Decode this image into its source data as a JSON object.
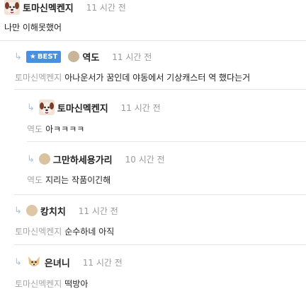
{
  "comments": [
    {
      "nick": "토마신멕켄지",
      "time": "11 시간 전",
      "mention": "",
      "text": "나만 이해못했어"
    },
    {
      "badge": "BEST",
      "nick": "역도",
      "time": "11 시간 전",
      "mention": "토마신멕켄지",
      "text": "아나운서가 꿈인데 야동에서 기상캐스터 역 했다는거"
    },
    {
      "nick": "토마신멕켄지",
      "time": "11 시간 전",
      "mention": "역도",
      "text": "아ㅋㅋㅋㅋ"
    },
    {
      "nick": "그만하세용가리",
      "time": "10 시간 전",
      "mention": "역도",
      "text": "지리는 작품이긴해"
    },
    {
      "nick": "캉치치",
      "time": "11 시간 전",
      "mention": "토마신멕켄지",
      "text": "순수하네 아직"
    },
    {
      "nick": "은녀니",
      "time": "11 시간 전",
      "mention": "토마신멕켄지",
      "text": "떡방아"
    }
  ],
  "icons": {
    "reply": "reply-arrow-icon",
    "best_star": "star-icon"
  },
  "colors": {
    "best_badge": "#4a90e2",
    "reply_arrow": "#a9c4dc",
    "mention": "#a6a6a6",
    "time": "#9a9a9a"
  }
}
